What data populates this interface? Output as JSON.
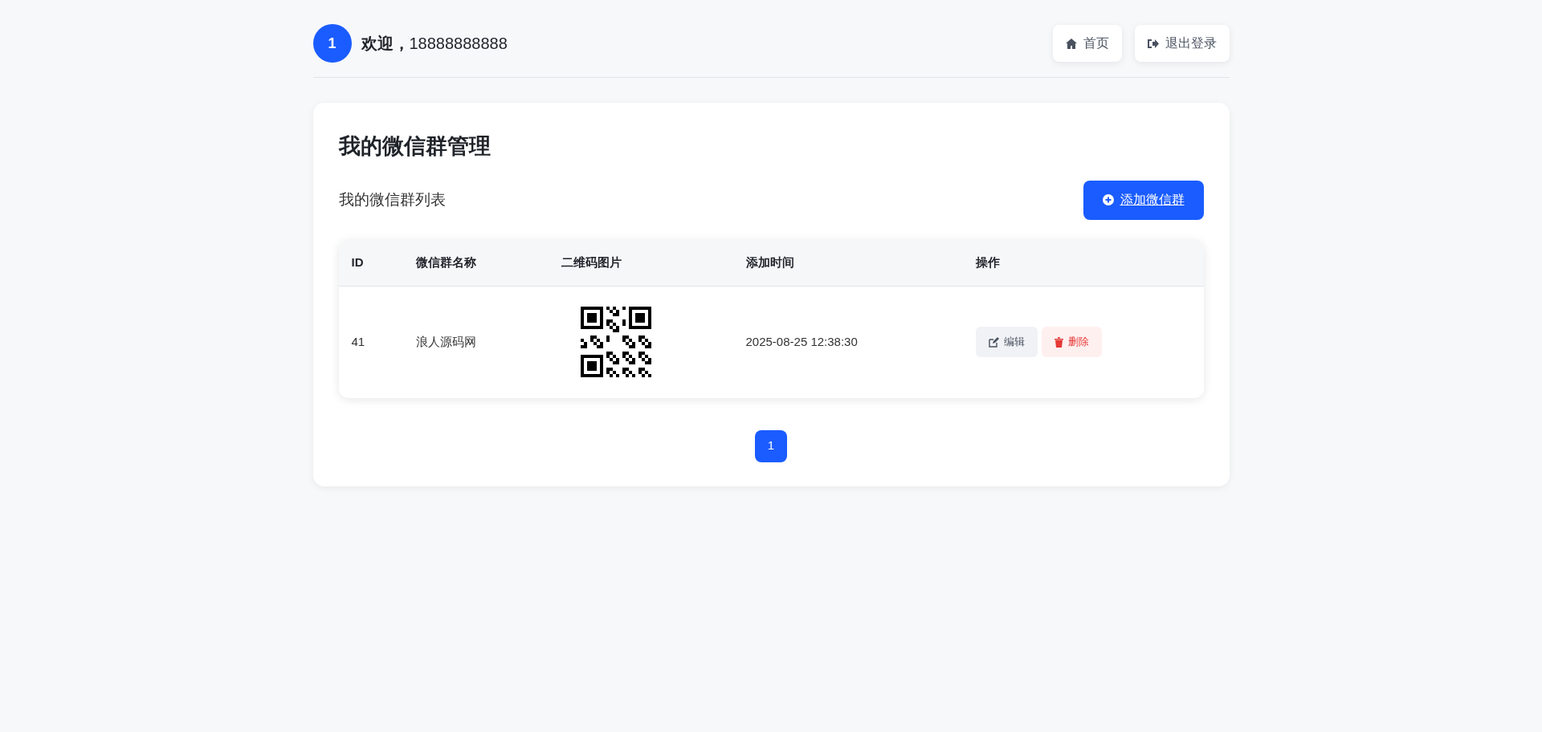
{
  "header": {
    "avatar": "1",
    "welcome": "**欢迎，**18888888888",
    "nav": [
      {
        "kind": "home",
        "label": "首页"
      },
      {
        "kind": "logout",
        "label": "退出登录"
      }
    ]
  },
  "card": {
    "title": "我的微信群管理",
    "subtitle": "我的微信群列表",
    "add_button": "添加微信群",
    "table": {
      "columns": [
        "ID",
        "微信群名称",
        "二维码图片",
        "添加时间",
        "操作"
      ],
      "rows": [
        {
          "id": "41",
          "name": "浪人源码网",
          "added": "2025-08-25 12:38:30",
          "actions": [
            {
              "kind": "edit",
              "label": "编辑"
            },
            {
              "kind": "delete",
              "label": "删除"
            }
          ]
        }
      ]
    },
    "pagination": [
      {
        "label": "1",
        "selected": true
      }
    ]
  }
}
